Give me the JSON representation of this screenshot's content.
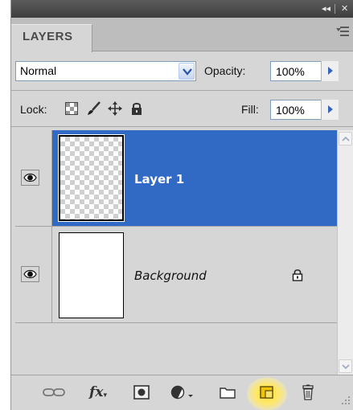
{
  "window": {
    "collapse_glyph": "◂◂",
    "close_glyph": "✕"
  },
  "panel": {
    "tab_label": "LAYERS",
    "menu_icon": "panel-menu-icon"
  },
  "blend": {
    "mode": "Normal",
    "opacity_label": "Opacity:",
    "opacity_value": "100%"
  },
  "lock": {
    "label": "Lock:",
    "icons": [
      "lock-transparent-pixels-icon",
      "lock-image-pixels-icon",
      "lock-position-icon",
      "lock-all-icon"
    ],
    "fill_label": "Fill:",
    "fill_value": "100%"
  },
  "layers": [
    {
      "name": "Layer 1",
      "visible": true,
      "selected": true,
      "thumbnail": "transparent-checkerboard"
    },
    {
      "name": "Background",
      "visible": true,
      "selected": false,
      "locked": true,
      "thumbnail": "white"
    }
  ],
  "toolbar": {
    "fx_label": "fx",
    "icons": [
      "link-layers-icon",
      "layer-style-icon",
      "add-mask-icon",
      "adjustment-layer-icon",
      "new-group-icon",
      "new-layer-icon",
      "delete-layer-icon"
    ],
    "highlighted": "new-layer-icon"
  },
  "colors": {
    "selection": "#316ac5",
    "panel_bg": "#d6d6d6",
    "title_bar": "#4a4a4a",
    "highlight_glow": "#ffe14a"
  }
}
